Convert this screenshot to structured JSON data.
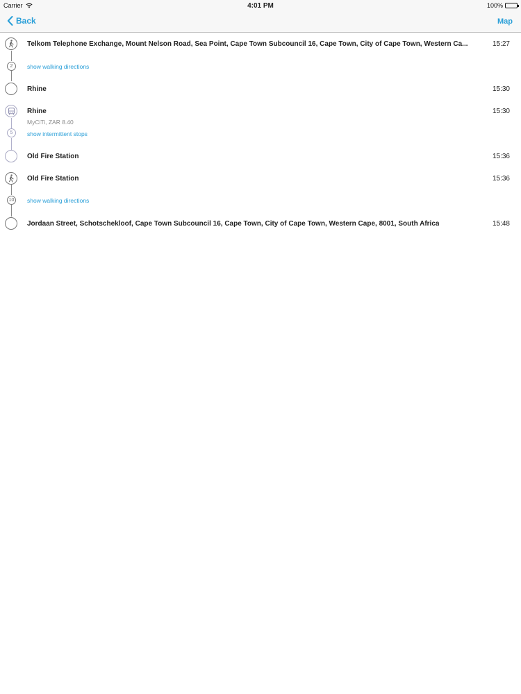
{
  "status_bar": {
    "carrier": "Carrier",
    "time": "4:01 PM",
    "battery": "100%",
    "battery_level": 1.0
  },
  "nav": {
    "back_label": "Back",
    "map_label": "Map"
  },
  "steps": [
    {
      "type": "walk",
      "title": "Telkom Telephone Exchange, Mount Nelson Road, Sea Point, Cape Town Subcouncil 16, Cape Town, City of Cape Town, Western Ca...",
      "time": "15:27"
    },
    {
      "type": "count",
      "count": "2",
      "link": "show walking directions"
    },
    {
      "type": "stop",
      "title": "Rhine",
      "time": "15:30"
    },
    {
      "type": "bus",
      "title": "Rhine",
      "subtitle": "MyCiTi, ZAR 8.40",
      "time": "15:30"
    },
    {
      "type": "count",
      "count": "5",
      "link": "show intermittent stops"
    },
    {
      "type": "stop",
      "title": "Old Fire Station",
      "time": "15:36"
    },
    {
      "type": "walk",
      "title": "Old Fire Station",
      "time": "15:36"
    },
    {
      "type": "count",
      "count": "10",
      "link": "show walking directions"
    },
    {
      "type": "stop",
      "title": "Jordaan Street, Schotschekloof, Cape Town Subcouncil 16, Cape Town, City of Cape Town, Western Cape, 8001, South Africa",
      "time": "15:48"
    }
  ],
  "colors": {
    "accent": "#2a9fd8",
    "walk_line": "#888888",
    "transit_line": "#b0b0cc"
  }
}
